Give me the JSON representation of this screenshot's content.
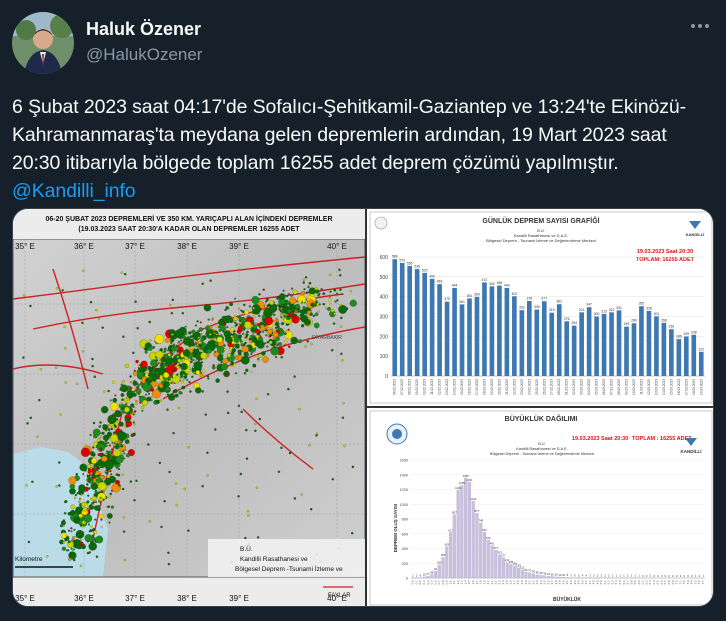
{
  "author": {
    "display_name": "Haluk Özener",
    "handle": "@HalukOzener"
  },
  "tweet": {
    "text": "6 Şubat 2023 saat 04:17'de Sofalıcı-Şehitkamil-Gaziantep ve 13:24'te Ekinözü-Kahramanmaraş'ta meydana gelen depremlerin ardından, 19 Mart 2023 saat 20:30 itibarıyla bölgede toplam 16255 adet deprem çözümü yapılmıştır. ",
    "mention": "@Kandilli_info"
  },
  "more_icon": "more-dots-icon",
  "colors": {
    "background": "#15202b",
    "text": "#f7f9f9",
    "secondary": "#8b98a5",
    "link": "#1d9bf0",
    "bar": "#3e78b2",
    "hist": "#c9c0dd"
  },
  "map": {
    "title_line1": "06-20 ŞUBAT 2023  DEPREMLERİ VE 350 KM. YARIÇAPLI ALAN İÇİNDEKİ DEPREMLER",
    "title_line2": "(19.03.2023 SAAT 20:30'A KADAR OLAN DEPREMLER   16255 ADET",
    "lon_labels": [
      "35° E",
      "36° E",
      "37° E",
      "38° E",
      "39° E",
      "40° E"
    ],
    "credit_line1": "Kandilli Rasathanesi ve",
    "credit_line2": "Bölgesel Deprem -Tsunami İzleme ve",
    "credit_bu": "B.Ü.",
    "scale_label": "Kilometre",
    "fault_label": "FAYLAR",
    "place_diyarbakir": "DİYARBAKIR"
  },
  "daily_chart": {
    "title": "GÜNLÜK DEPREM SAYISI GRAFİĞİ",
    "org_line1": "B.Ü.",
    "org_line2": "Kandilli Rasathanesi ve D.A.E.",
    "org_line3": "Bölgesel Deprem - Tsunami İzleme ve Değerlendirme Merkezi",
    "stamp_line1": "19.03.2023 Saat 20:30",
    "stamp_line2": "TOPLAM:   16255 ADET",
    "logo_text": "KANDİLLİ"
  },
  "magnitude_chart": {
    "title": "BÜYÜKLÜK DAĞILIMI",
    "org_line1": "B.Ü.",
    "org_line2": "Kandilli Rasathanesi ve D.A.E.",
    "org_line3": "Bölgesel Deprem - Tsunami İzleme ve Değerlendirme Merkezi",
    "stamp": "19.03.2023 Saat 20:30",
    "total": "TOPLAM : 16255 ADET",
    "ylabel": "DEPREM OLUŞ SAYISI",
    "xlabel": "BÜYÜKLÜK",
    "logo_text": "KANDİLLİ"
  },
  "chart_data": [
    {
      "type": "bar",
      "title": "GÜNLÜK DEPREM SAYISI GRAFİĞİ",
      "xlabel": "",
      "ylabel": "",
      "ylim": [
        0,
        600
      ],
      "yticks": [
        0,
        100,
        200,
        300,
        400,
        500,
        600
      ],
      "categories": [
        "06.02.2023",
        "07.02.2023",
        "08.02.2023",
        "09.02.2023",
        "10.02.2023",
        "11.02.2023",
        "12.02.2023",
        "13.02.2023",
        "14.02.2023",
        "15.02.2023",
        "16.02.2023",
        "17.02.2023",
        "18.02.2023",
        "19.02.2023",
        "20.02.2023",
        "21.02.2023",
        "22.02.2023",
        "23.02.2023",
        "24.02.2023",
        "25.02.2023",
        "26.02.2023",
        "27.02.2023",
        "28.02.2023",
        "01.03.2023",
        "02.03.2023",
        "03.03.2023",
        "04.03.2023",
        "05.03.2023",
        "06.03.2023",
        "07.03.2023",
        "08.03.2023",
        "09.03.2023",
        "10.03.2023",
        "11.03.2023",
        "12.03.2023",
        "13.03.2023",
        "14.03.2023",
        "15.03.2023",
        "16.03.2023",
        "17.03.2023",
        "18.03.2023",
        "19.03.2023"
      ],
      "values": [
        589,
        570,
        555,
        539,
        520,
        490,
        463,
        375,
        444,
        361,
        391,
        399,
        472,
        452,
        456,
        444,
        402,
        332,
        378,
        335,
        377,
        319,
        362,
        276,
        254,
        321,
        347,
        300,
        313,
        321,
        331,
        249,
        266,
        352,
        328,
        301,
        268,
        236,
        186,
        199,
        208,
        122
      ]
    },
    {
      "type": "bar",
      "title": "BÜYÜKLÜK DAĞILIMI",
      "xlabel": "BÜYÜKLÜK",
      "ylabel": "DEPREM OLUŞ SAYISI",
      "ylim": [
        0,
        1600
      ],
      "yticks": [
        0,
        200,
        400,
        600,
        800,
        1000,
        1200,
        1400,
        1600
      ],
      "categories": [
        "0.0",
        "0.1",
        "0.2",
        "0.3",
        "0.4",
        "0.5",
        "0.6",
        "0.7",
        "0.8",
        "0.9",
        "1.0",
        "1.1",
        "1.2",
        "1.3",
        "1.4",
        "1.5",
        "1.6",
        "1.7",
        "1.8",
        "1.9",
        "2.0",
        "2.1",
        "2.2",
        "2.3",
        "2.4",
        "2.5",
        "2.6",
        "2.7",
        "2.8",
        "2.9",
        "3.0",
        "3.1",
        "3.2",
        "3.3",
        "3.4",
        "3.5",
        "3.6",
        "3.7",
        "3.8",
        "3.9",
        "4.0",
        "4.1",
        "4.2",
        "4.3",
        "4.4",
        "4.5",
        "4.6",
        "4.7",
        "4.8",
        "4.9",
        "5.0",
        "5.1",
        "5.2",
        "5.3",
        "5.4",
        "5.5",
        "5.6",
        "5.7",
        "5.8",
        "5.9",
        "6.0",
        "6.1",
        "6.2",
        "6.3",
        "6.4",
        "6.5",
        "6.6",
        "6.7",
        "6.8",
        "6.9",
        "7.0",
        "7.1",
        "7.2",
        "7.3",
        "7.4",
        "7.5",
        "7.6",
        "7.7"
      ],
      "values": [
        1,
        2,
        6,
        15,
        27,
        48,
        94,
        180,
        280,
        425,
        617,
        857,
        1190,
        1255,
        1356,
        1301,
        1042,
        877,
        748,
        623,
        515,
        441,
        377,
        313,
        277,
        211,
        185,
        165,
        139,
        112,
        82,
        70,
        55,
        45,
        38,
        30,
        24,
        20,
        16,
        13,
        10,
        8,
        7,
        6,
        5,
        4,
        4,
        3,
        3,
        2,
        2,
        2,
        2,
        1,
        1,
        1,
        1,
        1,
        1,
        1,
        1,
        0,
        0,
        1,
        0,
        0,
        0,
        0,
        0,
        0,
        0,
        0,
        0,
        0,
        0,
        1,
        0,
        1
      ]
    }
  ]
}
